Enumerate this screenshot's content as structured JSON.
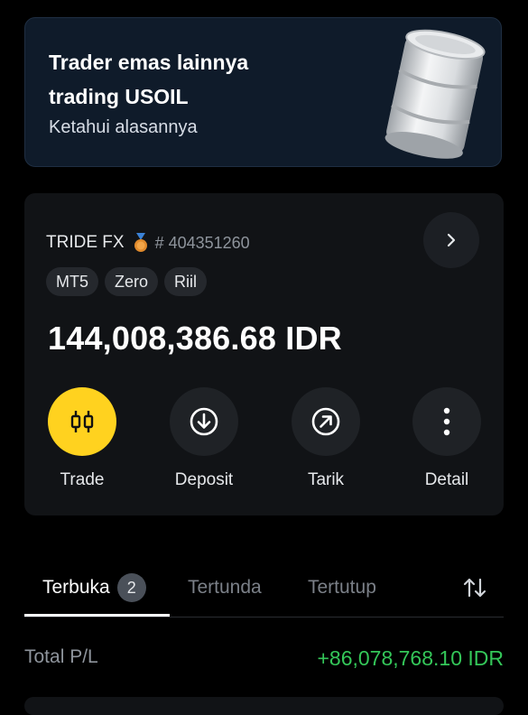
{
  "promo": {
    "title": "Trader emas lainnya trading USOIL",
    "subtitle": "Ketahui alasannya",
    "image": "oil-barrel-image"
  },
  "account": {
    "name": "TRIDE FX",
    "medal_icon": "medal-icon",
    "number": "# 404351260",
    "tags": [
      "MT5",
      "Zero",
      "Riil"
    ],
    "balance": "144,008,386.68 IDR",
    "actions": [
      {
        "label": "Trade",
        "icon": "trade-candles-icon"
      },
      {
        "label": "Deposit",
        "icon": "deposit-arrow-icon"
      },
      {
        "label": "Tarik",
        "icon": "withdraw-arrow-icon"
      },
      {
        "label": "Detail",
        "icon": "more-vertical-icon"
      }
    ]
  },
  "tabs": {
    "items": [
      {
        "label": "Terbuka",
        "badge": "2"
      },
      {
        "label": "Tertunda"
      },
      {
        "label": "Tertutup"
      }
    ],
    "sort_icon": "sort-arrows-icon"
  },
  "summary": {
    "label": "Total P/L",
    "value": "+86,078,768.10 IDR"
  },
  "colors": {
    "accent": "#ffd21f",
    "profit": "#34c759",
    "card": "#111316",
    "promo_bg": "#0f1b2a"
  }
}
